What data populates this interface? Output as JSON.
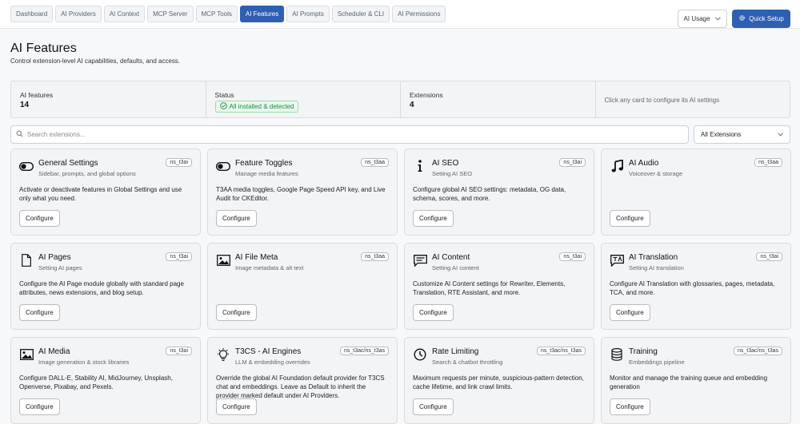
{
  "tabs": [
    {
      "label": "Dashboard",
      "active": false
    },
    {
      "label": "AI Providers",
      "active": false
    },
    {
      "label": "AI Context",
      "active": false
    },
    {
      "label": "MCP Server",
      "active": false
    },
    {
      "label": "MCP Tools",
      "active": false
    },
    {
      "label": "AI Features",
      "active": true
    },
    {
      "label": "AI Prompts",
      "active": false
    },
    {
      "label": "Scheduler & CLI",
      "active": false
    },
    {
      "label": "AI Permissions",
      "active": false
    }
  ],
  "header": {
    "usage_label": "AI Usage",
    "quick_setup_label": "Quick Setup"
  },
  "page": {
    "title": "AI Features",
    "subtitle": "Control extension-level AI capabilities, defaults, and access."
  },
  "stats": {
    "features_label": "AI features",
    "features_value": "14",
    "status_label": "Status",
    "status_value": "All installed & detected",
    "extensions_label": "Extensions",
    "extensions_value": "4",
    "hint": "Click any card to configure its AI settings"
  },
  "search": {
    "placeholder": "Search extensions..."
  },
  "filter": {
    "selected": "All Extensions"
  },
  "cards": [
    {
      "icon": "toggle-icon",
      "title": "General Settings",
      "subtitle": "Sidebar, prompts, and global options",
      "tag": "ns_t3ai",
      "description": "Activate or deactivate features in Global Settings and use only what you need.",
      "button": "Configure"
    },
    {
      "icon": "toggle-icon",
      "title": "Feature Toggles",
      "subtitle": "Manage media features",
      "tag": "ns_t3aa",
      "description": "T3AA media toggles, Google Page Speed API key, and Live Audit for CKEditor.",
      "button": "Configure"
    },
    {
      "icon": "info-icon",
      "title": "AI SEO",
      "subtitle": "Setting AI SEO",
      "tag": "ns_t3ai",
      "description": "Configure global AI SEO settings: metadata, OG data, schema, scores, and more.",
      "button": "Configure"
    },
    {
      "icon": "music-note-icon",
      "title": "AI Audio",
      "subtitle": "Voiceover & storage",
      "tag": "ns_t3aa",
      "description": "",
      "button": "Configure"
    },
    {
      "icon": "page-icon",
      "title": "AI Pages",
      "subtitle": "Setting AI pages",
      "tag": "ns_t3ai",
      "description": "Configure the AI Page module globally with standard page attributes, news extensions, and blog setup.",
      "button": "Configure"
    },
    {
      "icon": "image-icon",
      "title": "AI File Meta",
      "subtitle": "Image metadata & alt text",
      "tag": "ns_t3aa",
      "description": "",
      "button": "Configure"
    },
    {
      "icon": "chat-icon",
      "title": "AI Content",
      "subtitle": "Setting AI content",
      "tag": "ns_t3ai",
      "description": "Customize AI Content settings for Rewriter, Elements, Translation, RTE Assistant, and more.",
      "button": "Configure"
    },
    {
      "icon": "translate-icon",
      "title": "AI Translation",
      "subtitle": "Setting AI translation",
      "tag": "ns_t3ai",
      "description": "Configure AI Translation with glossaries, pages, metadata, TCA, and more.",
      "button": "Configure"
    },
    {
      "icon": "image-icon",
      "title": "AI Media",
      "subtitle": "Image generation & stock libraries",
      "tag": "ns_t3ai",
      "description": "Configure DALL-E, Stability AI, MidJourney, Unsplash, Openverse, Pixabay, and Pexels.",
      "button": "Configure"
    },
    {
      "icon": "lightbulb-icon",
      "title": "T3CS - AI Engines",
      "subtitle": "LLM & embedding overrides",
      "tag": "ns_t3ac/ns_t3as",
      "description": "Override the global AI Foundation default provider for T3CS chat and embeddings. Leave as Default to inherit the provider marked default under AI Providers.",
      "button": "Configure"
    },
    {
      "icon": "clock-icon",
      "title": "Rate Limiting",
      "subtitle": "Search & chatbot throttling",
      "tag": "ns_t3ac/ns_t3as",
      "description": "Maximum requests per minute, suspicious-pattern detection, cache lifetime, and link crawl limits.",
      "button": "Configure"
    },
    {
      "icon": "database-icon",
      "title": "Training",
      "subtitle": "Embeddings pipeline",
      "tag": "ns_t3ac/ns_t3as",
      "description": "Monitor and manage the training queue and embedding generation",
      "button": "Configure"
    }
  ]
}
